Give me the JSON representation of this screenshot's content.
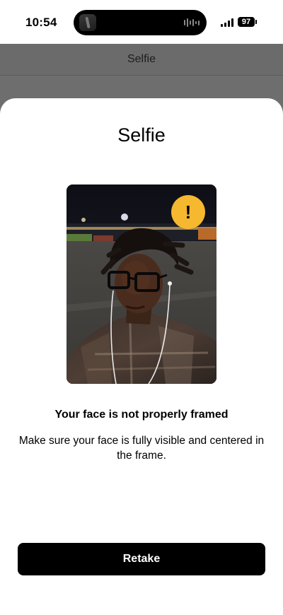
{
  "status_bar": {
    "time": "10:54",
    "battery": "97",
    "icons": [
      "app-icon",
      "audio-wave-icon",
      "signal-icon",
      "battery-icon"
    ]
  },
  "background_page": {
    "title": "Selfie"
  },
  "sheet": {
    "title": "Selfie",
    "photo": "selfie-photo",
    "warning_icon": "!",
    "heading": "Your face is not properly framed",
    "message": "Make sure your face is fully visible and centered in the frame.",
    "retake_label": "Retake"
  },
  "colors": {
    "warning": "#f5b82e",
    "button_bg": "#000000",
    "button_text": "#ffffff",
    "overlay": "#6e6e6e"
  }
}
